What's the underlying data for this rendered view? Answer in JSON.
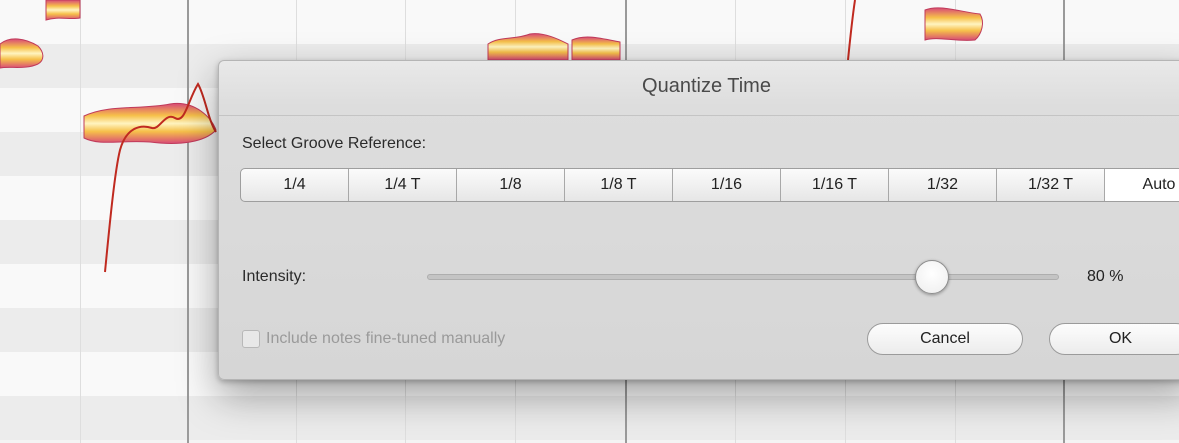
{
  "dialog": {
    "title": "Quantize Time",
    "groove_label": "Select Groove Reference:",
    "groove_options": [
      "1/4",
      "1/4 T",
      "1/8",
      "1/8 T",
      "1/16",
      "1/16 T",
      "1/32",
      "1/32 T",
      "Auto"
    ],
    "selected_groove": "Auto",
    "intensity_label": "Intensity:",
    "intensity_percent": 80,
    "intensity_text": "80 %",
    "checkbox_label": "Include notes fine-tuned manually",
    "checkbox_checked": false,
    "cancel_label": "Cancel",
    "ok_label": "OK"
  },
  "colors": {
    "note_fill": "#f6c04a",
    "note_edge": "#d04070",
    "pitch_curve": "#c02a20"
  }
}
